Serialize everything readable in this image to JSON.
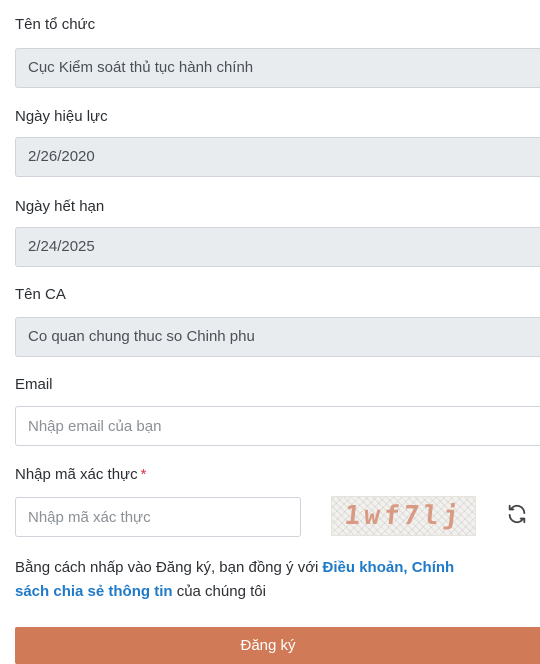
{
  "form": {
    "org_name": {
      "label": "Tên tổ chức",
      "value": "Cục Kiểm soát thủ tục hành chính"
    },
    "valid_from": {
      "label": "Ngày hiệu lực",
      "value": "2/26/2020"
    },
    "valid_to": {
      "label": "Ngày hết hạn",
      "value": "2/24/2025"
    },
    "ca_name": {
      "label": "Tên CA",
      "value": "Co quan chung thuc so Chinh phu"
    },
    "email": {
      "label": "Email",
      "placeholder": "Nhập email của bạn"
    },
    "captcha": {
      "label": "Nhập mã xác thực",
      "required_mark": "*",
      "placeholder": "Nhập mã xác thực",
      "image_text": "1wf7lj"
    }
  },
  "terms": {
    "prefix": "Bằng cách nhấp vào Đăng ký, bạn đồng ý với ",
    "link_terms": "Điều khoản, Chính",
    "link_policy": "sách chia sẻ thông tin",
    "suffix": " của chúng tôi"
  },
  "submit_label": "Đăng ký",
  "colors": {
    "readonly_bg": "#e9ecef",
    "link": "#1f7ac8",
    "submit_bg": "#d07a58",
    "required": "#dc3545"
  },
  "icons": {
    "refresh": "refresh-icon"
  }
}
